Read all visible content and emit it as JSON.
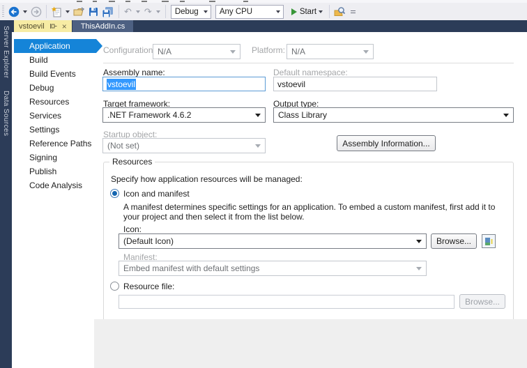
{
  "toolbar": {
    "config_value": "Debug",
    "platform_value": "Any CPU",
    "start_label": "Start"
  },
  "tabs": [
    {
      "label": "vstoevil",
      "active": true
    },
    {
      "label": "ThisAddIn.cs",
      "active": false
    }
  ],
  "side_strip": {
    "items": [
      "Server Explorer",
      "Data Sources"
    ]
  },
  "nav": {
    "selected": "Application",
    "items": [
      "Application",
      "Build",
      "Build Events",
      "Debug",
      "Resources",
      "Services",
      "Settings",
      "Reference Paths",
      "Signing",
      "Publish",
      "Code Analysis"
    ]
  },
  "form": {
    "configuration_label": "Configuration:",
    "configuration_value": "N/A",
    "platform_label": "Platform:",
    "platform_value": "N/A",
    "assembly_name_label": "Assembly name:",
    "assembly_name_value": "vstoevil",
    "default_namespace_label": "Default namespace:",
    "default_namespace_value": "vstoevil",
    "target_framework_label": "Target framework:",
    "target_framework_value": ".NET Framework 4.6.2",
    "output_type_label": "Output type:",
    "output_type_value": "Class Library",
    "startup_object_label": "Startup object:",
    "startup_object_value": "(Not set)",
    "assembly_information_button": "Assembly Information...",
    "resources": {
      "title": "Resources",
      "description": "Specify how application resources will be managed:",
      "icon_and_manifest_radio": "Icon and manifest",
      "manifest_help_line1": "A manifest determines specific settings for an application. To embed a custom manifest, first add it to",
      "manifest_help_line2": "your project and then select it from the list below.",
      "icon_label": "Icon:",
      "icon_value": "(Default Icon)",
      "browse_button": "Browse...",
      "manifest_label": "Manifest:",
      "manifest_value": "Embed manifest with default settings",
      "resource_file_radio": "Resource file:",
      "resource_file_value": "",
      "resource_browse_button": "Browse..."
    }
  },
  "colors": {
    "accent_selection": "#3399ff",
    "nav_selected": "#1584d8",
    "tab_active_bg": "#f7eca4",
    "tab_inactive_bg": "#4d6082",
    "strip_bg": "#2c3c58",
    "toolbar_bg": "#eeeef2",
    "start_green": "#389638",
    "save_blue": "#2e6fc0"
  }
}
